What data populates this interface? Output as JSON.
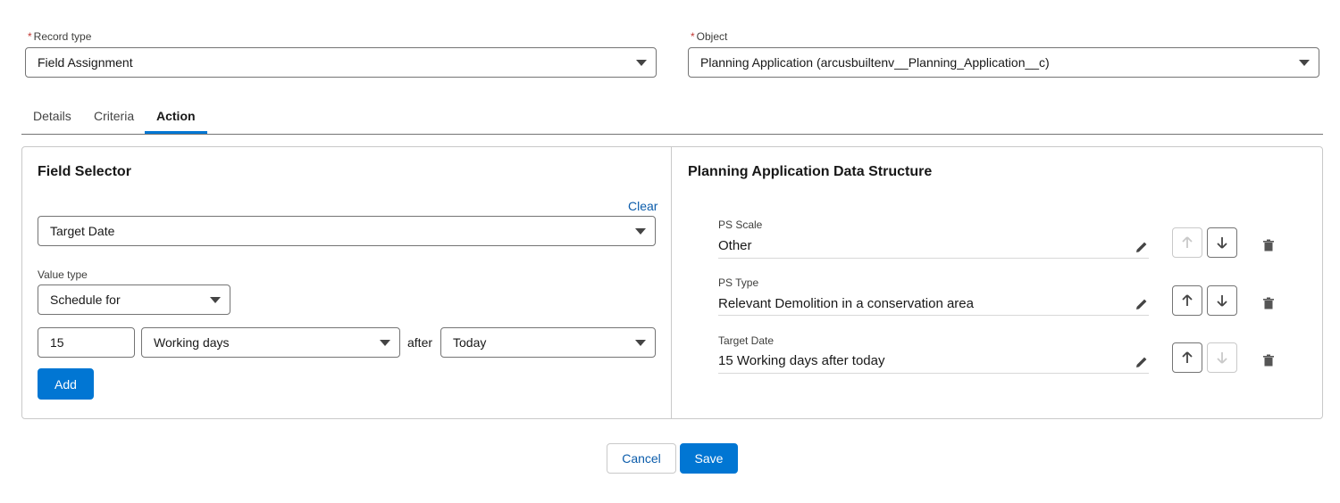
{
  "record_type": {
    "required_mark": "*",
    "label": "Record type",
    "value": "Field Assignment"
  },
  "object": {
    "required_mark": "*",
    "label": "Object",
    "value": "Planning Application (arcusbuiltenv__Planning_Application__c)"
  },
  "tabs": [
    {
      "label": "Details",
      "active": false
    },
    {
      "label": "Criteria",
      "active": false
    },
    {
      "label": "Action",
      "active": true
    }
  ],
  "field_selector": {
    "title": "Field Selector",
    "clear_label": "Clear",
    "field_value": "Target Date",
    "value_type_label": "Value type",
    "value_type_value": "Schedule for",
    "amount": "15",
    "unit_value": "Working days",
    "after_label": "after",
    "anchor_value": "Today",
    "add_label": "Add"
  },
  "data_structure": {
    "title": "Planning Application Data Structure",
    "fields": [
      {
        "label": "PS Scale",
        "value": "Other",
        "up_enabled": false,
        "down_enabled": true
      },
      {
        "label": "PS Type",
        "value": "Relevant Demolition in a conservation area",
        "up_enabled": true,
        "down_enabled": true
      },
      {
        "label": "Target Date",
        "value": "15 Working days after today",
        "up_enabled": true,
        "down_enabled": false
      }
    ]
  },
  "footer": {
    "cancel_label": "Cancel",
    "save_label": "Save"
  },
  "colors": {
    "brand": "#0176d3",
    "link": "#0b5cab",
    "required": "#c23934"
  }
}
